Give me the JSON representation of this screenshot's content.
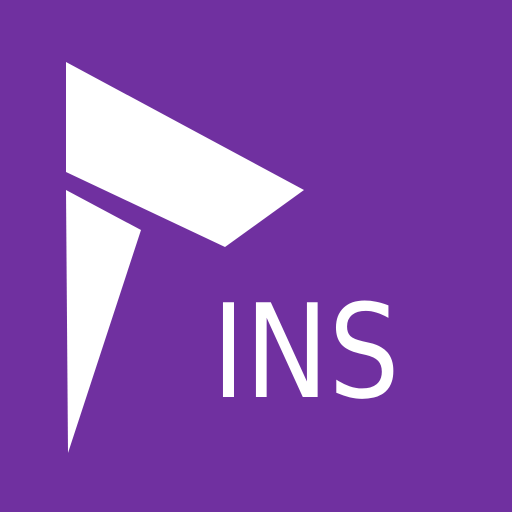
{
  "app_icon": {
    "wordmark": "INS",
    "mark_icon": "flag-arrow-icon",
    "colors": {
      "background": "#7030A0",
      "foreground": "#FFFFFF"
    }
  }
}
